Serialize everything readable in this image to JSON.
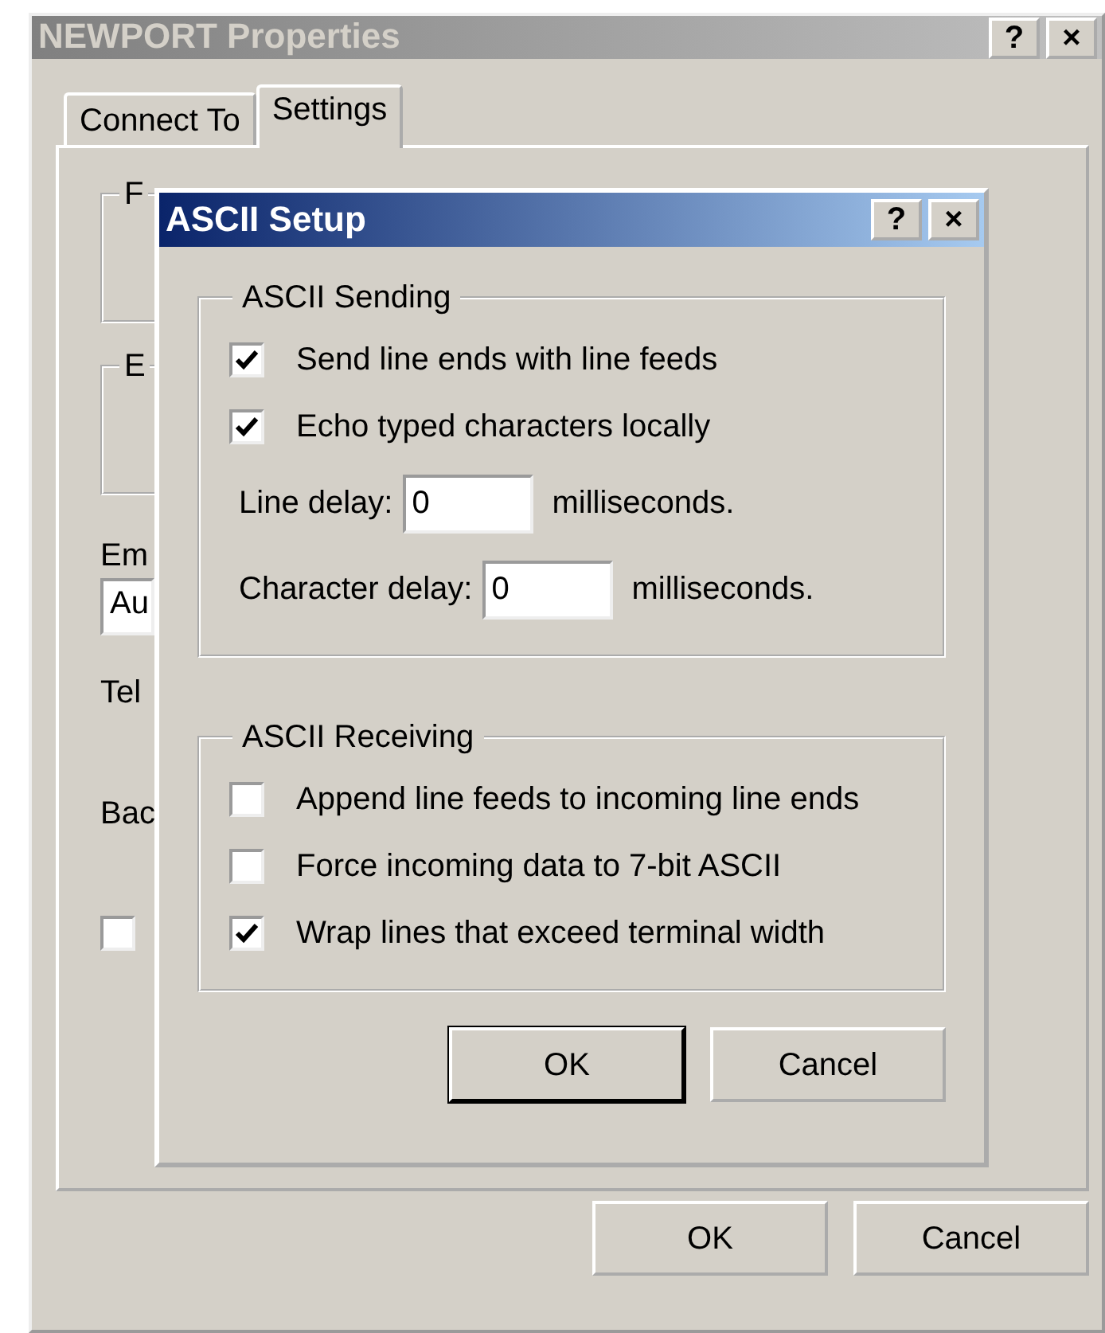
{
  "window": {
    "title": "NEWPORT Properties",
    "active": false,
    "title_buttons": [
      "?",
      "×"
    ]
  },
  "tabs": [
    {
      "label": "Connect To",
      "selected": false
    },
    {
      "label": "Settings",
      "selected": true
    }
  ],
  "settings_fragments": [
    {
      "kind": "group",
      "text": "F"
    },
    {
      "kind": "group",
      "text": "E"
    },
    {
      "kind": "label",
      "text": "Em"
    },
    {
      "kind": "field",
      "text": "Au"
    },
    {
      "kind": "label",
      "text": "Tel"
    },
    {
      "kind": "label",
      "text": "Bac"
    },
    {
      "kind": "checkbox",
      "checked": false
    }
  ],
  "dialog": {
    "title": "ASCII Setup",
    "active": true,
    "title_buttons": [
      "?",
      "×"
    ],
    "groups": [
      {
        "title": "ASCII Sending",
        "items": [
          {
            "kind": "checkbox",
            "label": "Send line ends with line feeds",
            "checked": true
          },
          {
            "kind": "checkbox",
            "label": "Echo typed characters locally",
            "checked": true
          },
          {
            "kind": "delay",
            "label": "Line delay:",
            "value": "0",
            "unit": "milliseconds."
          },
          {
            "kind": "delay",
            "label": "Character delay:",
            "value": "0",
            "unit": "milliseconds."
          }
        ]
      },
      {
        "title": "ASCII Receiving",
        "items": [
          {
            "kind": "checkbox",
            "label": "Append line feeds to incoming line ends",
            "checked": false
          },
          {
            "kind": "checkbox",
            "label": "Force incoming data to 7-bit ASCII",
            "checked": false
          },
          {
            "kind": "checkbox",
            "label": "Wrap lines that exceed terminal width",
            "checked": true
          }
        ]
      }
    ],
    "buttons": [
      {
        "label": "OK",
        "default": true
      },
      {
        "label": "Cancel",
        "default": false
      }
    ]
  },
  "buttons": [
    "OK",
    "Cancel"
  ]
}
